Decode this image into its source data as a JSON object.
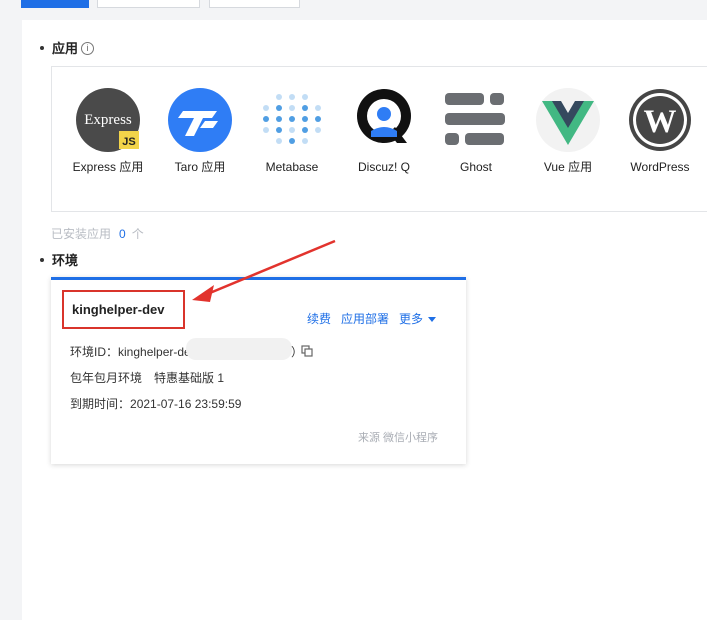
{
  "apps_section": {
    "title": "应用",
    "info_icon": "info-icon"
  },
  "apps": [
    {
      "label": "Express 应用",
      "icon": "express-logo"
    },
    {
      "label": "Taro 应用",
      "icon": "taro-logo"
    },
    {
      "label": "Metabase",
      "icon": "metabase-logo"
    },
    {
      "label": "Discuz! Q",
      "icon": "discuz-logo"
    },
    {
      "label": "Ghost",
      "icon": "ghost-logo"
    },
    {
      "label": "Vue 应用",
      "icon": "vue-logo"
    },
    {
      "label": "WordPress",
      "icon": "wordpress-logo"
    }
  ],
  "installed": {
    "label": "已安装应用",
    "count": "0",
    "unit": "个"
  },
  "env_section": {
    "title": "环境"
  },
  "env": {
    "name": "kinghelper-dev",
    "actions": {
      "renew": "续费",
      "deploy": "应用部署",
      "more": "更多"
    },
    "id_label": "环境ID：",
    "id_value": "kinghelper-de",
    "id_suffix": "）",
    "billing": "包年包月环境",
    "plan": "特惠基础版 1",
    "expiry_label": "到期时间：",
    "expiry_value": "2021-07-16 23:59:59",
    "source": "来源 微信小程序"
  },
  "colors": {
    "accent": "#1f6fe6",
    "highlight": "#d9342b",
    "muted": "#a9adb4"
  }
}
